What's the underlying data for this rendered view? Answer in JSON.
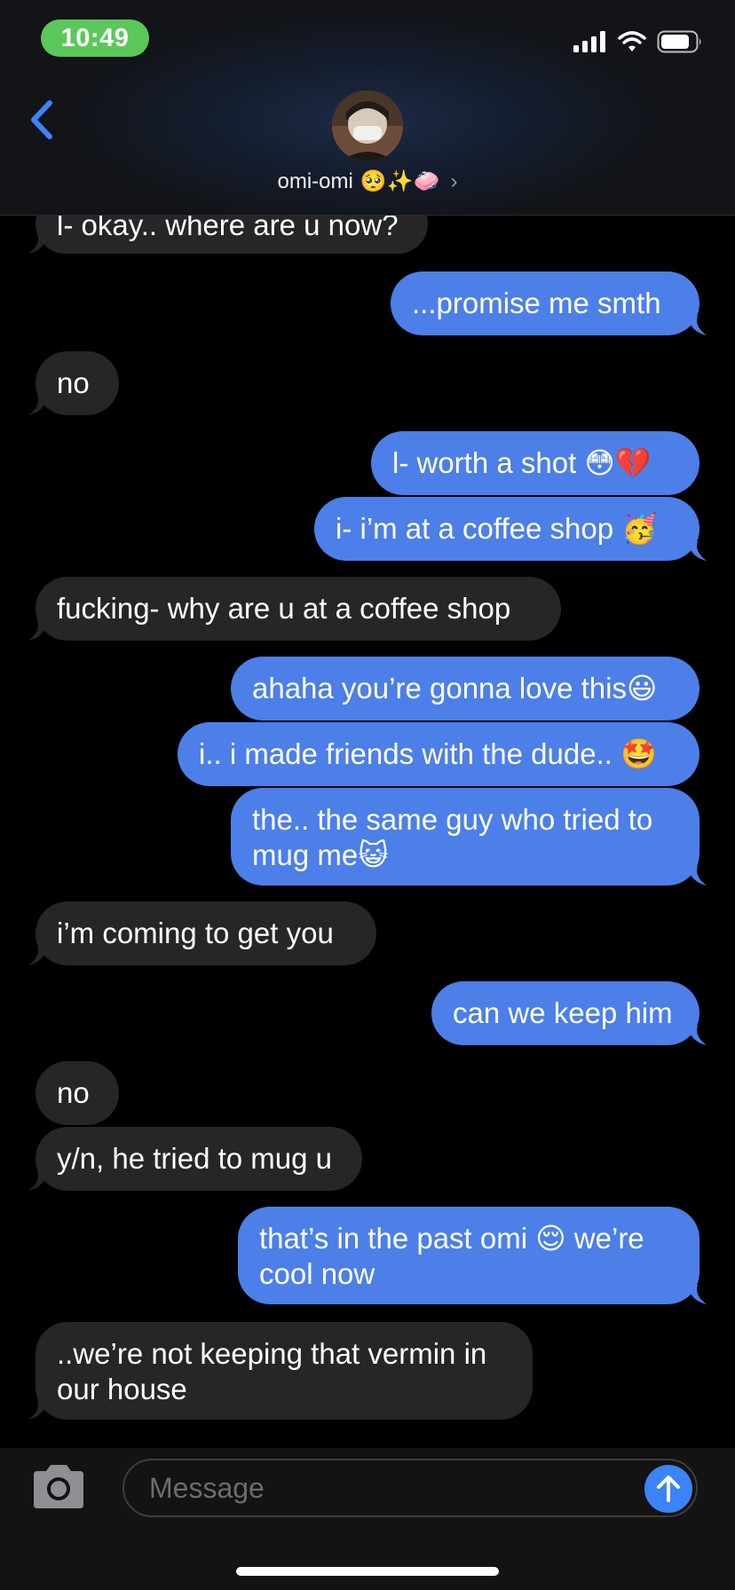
{
  "status_bar": {
    "time": "10:49",
    "icons": [
      "cellular-signal-icon",
      "wifi-icon",
      "battery-icon"
    ]
  },
  "header": {
    "back_icon": "chevron-left-icon",
    "contact_name": "omi-omi",
    "contact_emojis": "🥺✨🧼",
    "chevron": "›"
  },
  "colors": {
    "outgoing_bubble": "#4c7fe8",
    "incoming_bubble": "#262628",
    "accent": "#3a84f7",
    "status_pill": "#5ac85a"
  },
  "messages": [
    {
      "from": "them",
      "text": "l- okay.. where are u now?"
    },
    {
      "from": "me",
      "text": "...promise me smth"
    },
    {
      "from": "them",
      "text": "no"
    },
    {
      "from": "me",
      "text": "l- worth a shot 😳💔"
    },
    {
      "from": "me",
      "text": "i- i’m at a coffee shop 🥳"
    },
    {
      "from": "them",
      "text": "fucking- why are u at a coffee shop"
    },
    {
      "from": "me",
      "text": "ahaha you’re gonna love this😃"
    },
    {
      "from": "me",
      "text": "i.. i made friends with the dude.. 🤩"
    },
    {
      "from": "me",
      "text": "the.. the same guy who tried to mug me😺"
    },
    {
      "from": "them",
      "text": "i’m coming to get you"
    },
    {
      "from": "me",
      "text": "can we keep him"
    },
    {
      "from": "them",
      "text": "no"
    },
    {
      "from": "them",
      "text": "y/n, he tried to mug u"
    },
    {
      "from": "me",
      "text": "that’s in the past omi 😌 we’re cool now"
    },
    {
      "from": "them",
      "text": "..we’re not keeping that vermin in our house"
    }
  ],
  "input_bar": {
    "placeholder": "Message",
    "camera_icon": "camera-icon",
    "send_icon": "arrow-up-icon"
  }
}
